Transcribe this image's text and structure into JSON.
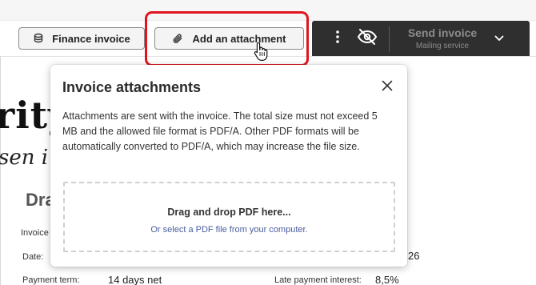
{
  "toolbar": {
    "finance_label": "Finance invoice",
    "attach_label": "Add an attachment",
    "send_label": "Send invoice",
    "send_sublabel": "Mailing service"
  },
  "document": {
    "title_fragment": "rity",
    "script_fragment": "sen i",
    "draft_fragment": "Dra",
    "invoice_label_fragment": "Invoice",
    "date_label": "Date:",
    "date_value_fragment": "26",
    "payment_term_label": "Payment term:",
    "payment_term_value": "14 days net",
    "late_interest_label": "Late payment interest:",
    "late_interest_value": "8,5%"
  },
  "popover": {
    "title": "Invoice attachments",
    "body": "Attachments are sent with the invoice. The total size must not exceed 5 MB and the allowed file format is PDF/A. Other PDF formats will be automatically converted to PDF/A, which may increase the file size.",
    "drop_main": "Drag and drop PDF here...",
    "drop_link": "Or select a PDF file from your computer."
  },
  "colors": {
    "highlight": "#e0141e",
    "dark_bar": "#2f2f2f",
    "link": "#4a5d9f"
  },
  "icons": {
    "finance": "coins-icon",
    "attach": "paperclip-icon",
    "more": "vertical-dots-icon",
    "visibility": "eye-off-icon",
    "dropdown": "chevron-down-icon",
    "close": "close-icon",
    "cursor": "hand-pointer-icon"
  }
}
